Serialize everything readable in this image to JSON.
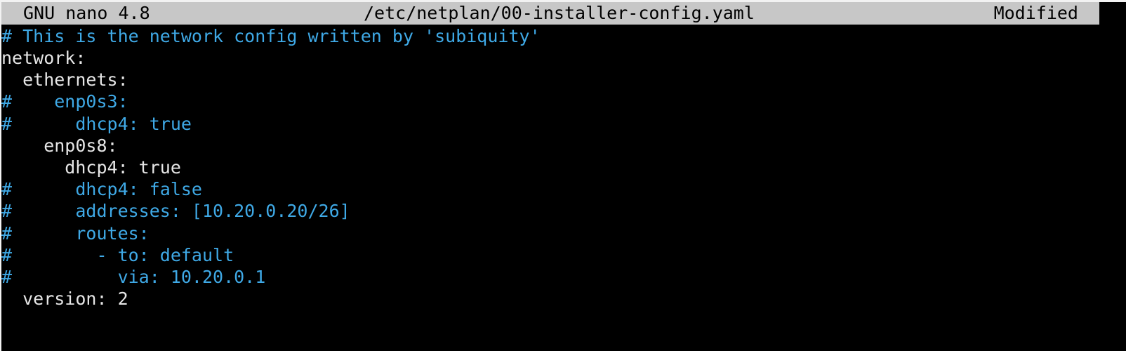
{
  "title_bar": {
    "app": "GNU nano 4.8",
    "file": "/etc/netplan/00-installer-config.yaml",
    "status": "Modified"
  },
  "editor": {
    "lines": [
      {
        "text": "# This is the network config written by 'subiquity'",
        "comment": true
      },
      {
        "text": "network:",
        "comment": false
      },
      {
        "text": "  ethernets:",
        "comment": false
      },
      {
        "text": "#    enp0s3:",
        "comment": true
      },
      {
        "text": "#      dhcp4: true",
        "comment": true
      },
      {
        "text": "    enp0s8:",
        "comment": false
      },
      {
        "text": "      dhcp4: true",
        "comment": false
      },
      {
        "text": "#      dhcp4: false",
        "comment": true
      },
      {
        "text": "#      addresses: [10.20.0.20/26]",
        "comment": true
      },
      {
        "text": "#      routes:",
        "comment": true
      },
      {
        "text": "#        - to: default",
        "comment": true
      },
      {
        "text": "#          via: 10.20.0.1",
        "comment": true
      },
      {
        "text": "  version: 2",
        "comment": false
      }
    ]
  },
  "colors": {
    "background": "#000000",
    "text": "#e6e6e6",
    "comment": "#3fa9e6",
    "title_bar": "#c7c7c7"
  }
}
